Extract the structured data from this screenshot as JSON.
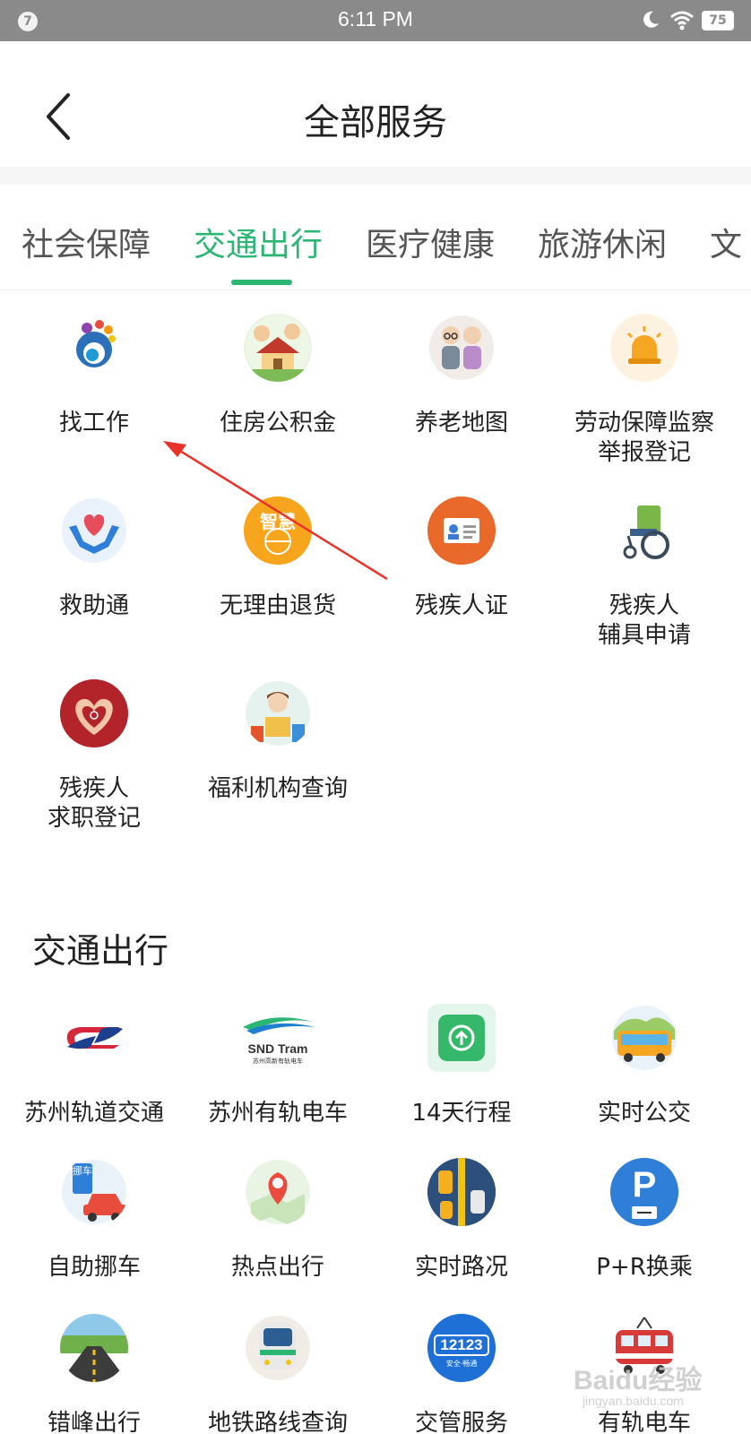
{
  "status_bar": {
    "notification_count": "7",
    "time": "6:11 PM",
    "battery": "75",
    "icons": [
      "moon-icon",
      "wifi-icon",
      "battery-icon"
    ]
  },
  "header": {
    "title": "全部服务",
    "back_icon": "chevron-left-icon"
  },
  "tabs": [
    {
      "label": "社会保障",
      "active": false
    },
    {
      "label": "交通出行",
      "active": true
    },
    {
      "label": "医疗健康",
      "active": false
    },
    {
      "label": "旅游休闲",
      "active": false
    },
    {
      "label": "文",
      "active": false
    }
  ],
  "accent_color": "#2bb673",
  "social_services": [
    {
      "label": "找工作",
      "icon": "job-search-icon"
    },
    {
      "label": "住房公积金",
      "icon": "housing-fund-icon"
    },
    {
      "label": "养老地图",
      "icon": "elderly-care-map-icon"
    },
    {
      "label": "劳动保障监察\n举报登记",
      "icon": "alarm-light-icon"
    },
    {
      "label": "救助通",
      "icon": "heart-hands-icon"
    },
    {
      "label": "无理由退货",
      "icon": "return-goods-icon"
    },
    {
      "label": "残疾人证",
      "icon": "id-card-icon"
    },
    {
      "label": "残疾人\n辅具申请",
      "icon": "wheelchair-icon"
    },
    {
      "label": "残疾人\n求职登记",
      "icon": "heart-disability-icon"
    },
    {
      "label": "福利机构查询",
      "icon": "welfare-reading-icon"
    }
  ],
  "icon_badges": {
    "return_goods": "智慧"
  },
  "transport_section": {
    "title": "交通出行",
    "items": [
      {
        "label": "苏州轨道交通",
        "icon": "suzhou-metro-logo-icon"
      },
      {
        "label": "苏州有轨电车",
        "icon": "snd-tram-logo-icon",
        "logo_text": "SND Tram",
        "logo_sub": "苏州高新有轨电车"
      },
      {
        "label": "14天行程",
        "icon": "itinerary-upload-icon"
      },
      {
        "label": "实时公交",
        "icon": "bus-icon"
      },
      {
        "label": "自助挪车",
        "icon": "move-car-icon",
        "badge": "挪车"
      },
      {
        "label": "热点出行",
        "icon": "map-pin-icon"
      },
      {
        "label": "实时路况",
        "icon": "road-traffic-icon"
      },
      {
        "label": "P+R换乘",
        "icon": "parking-icon",
        "badge": "P"
      },
      {
        "label": "错峰出行",
        "icon": "highway-icon"
      },
      {
        "label": "地铁路线查询",
        "icon": "subway-train-icon"
      },
      {
        "label": "交管服务",
        "icon": "traffic-12123-icon",
        "badge": "12123",
        "badge_sub": "安全·畅通"
      },
      {
        "label": "有轨电车",
        "icon": "tram-icon"
      }
    ]
  },
  "watermark": {
    "text": "Baidu经验",
    "sub": "jingyan.baidu.com"
  }
}
